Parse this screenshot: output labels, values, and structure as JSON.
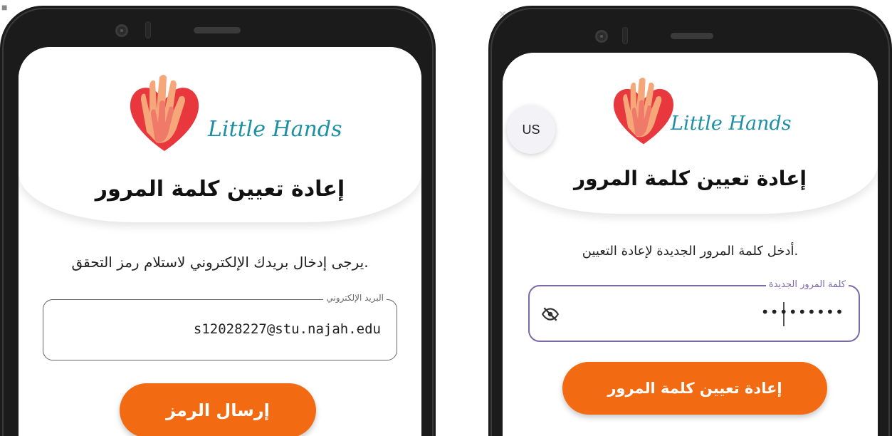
{
  "left_screen": {
    "app_name": "Little Hands",
    "title": "إعادة تعيين كلمة المرور",
    "instruction": "يرجى إدخال بريدك الإلكتروني لاستلام رمز التحقق.",
    "email_field": {
      "label": "البريد الإلكتروني",
      "value": "s12028227@stu.najah.edu"
    },
    "submit_label": "إرسال الرمز"
  },
  "right_screen": {
    "app_name": "Little Hands",
    "language_badge": "US",
    "title": "إعادة تعيين كلمة المرور",
    "instruction": "أدخل كلمة المرور الجديدة لإعادة التعيين.",
    "password_field": {
      "label": "كلمة المرور الجديدة",
      "value": "•••••••••",
      "toggle_icon": "eye-off-icon"
    },
    "submit_label": "إعادة تعيين كلمة المرور"
  },
  "colors": {
    "accent": "#f26a12",
    "logo_text": "#1c8fa3",
    "heart": "#e8383d",
    "focused_border": "#7a6aa8"
  },
  "icons": [
    "phone-camera-icon",
    "logo-hands-heart-icon",
    "eye-off-icon",
    "close-icon"
  ]
}
